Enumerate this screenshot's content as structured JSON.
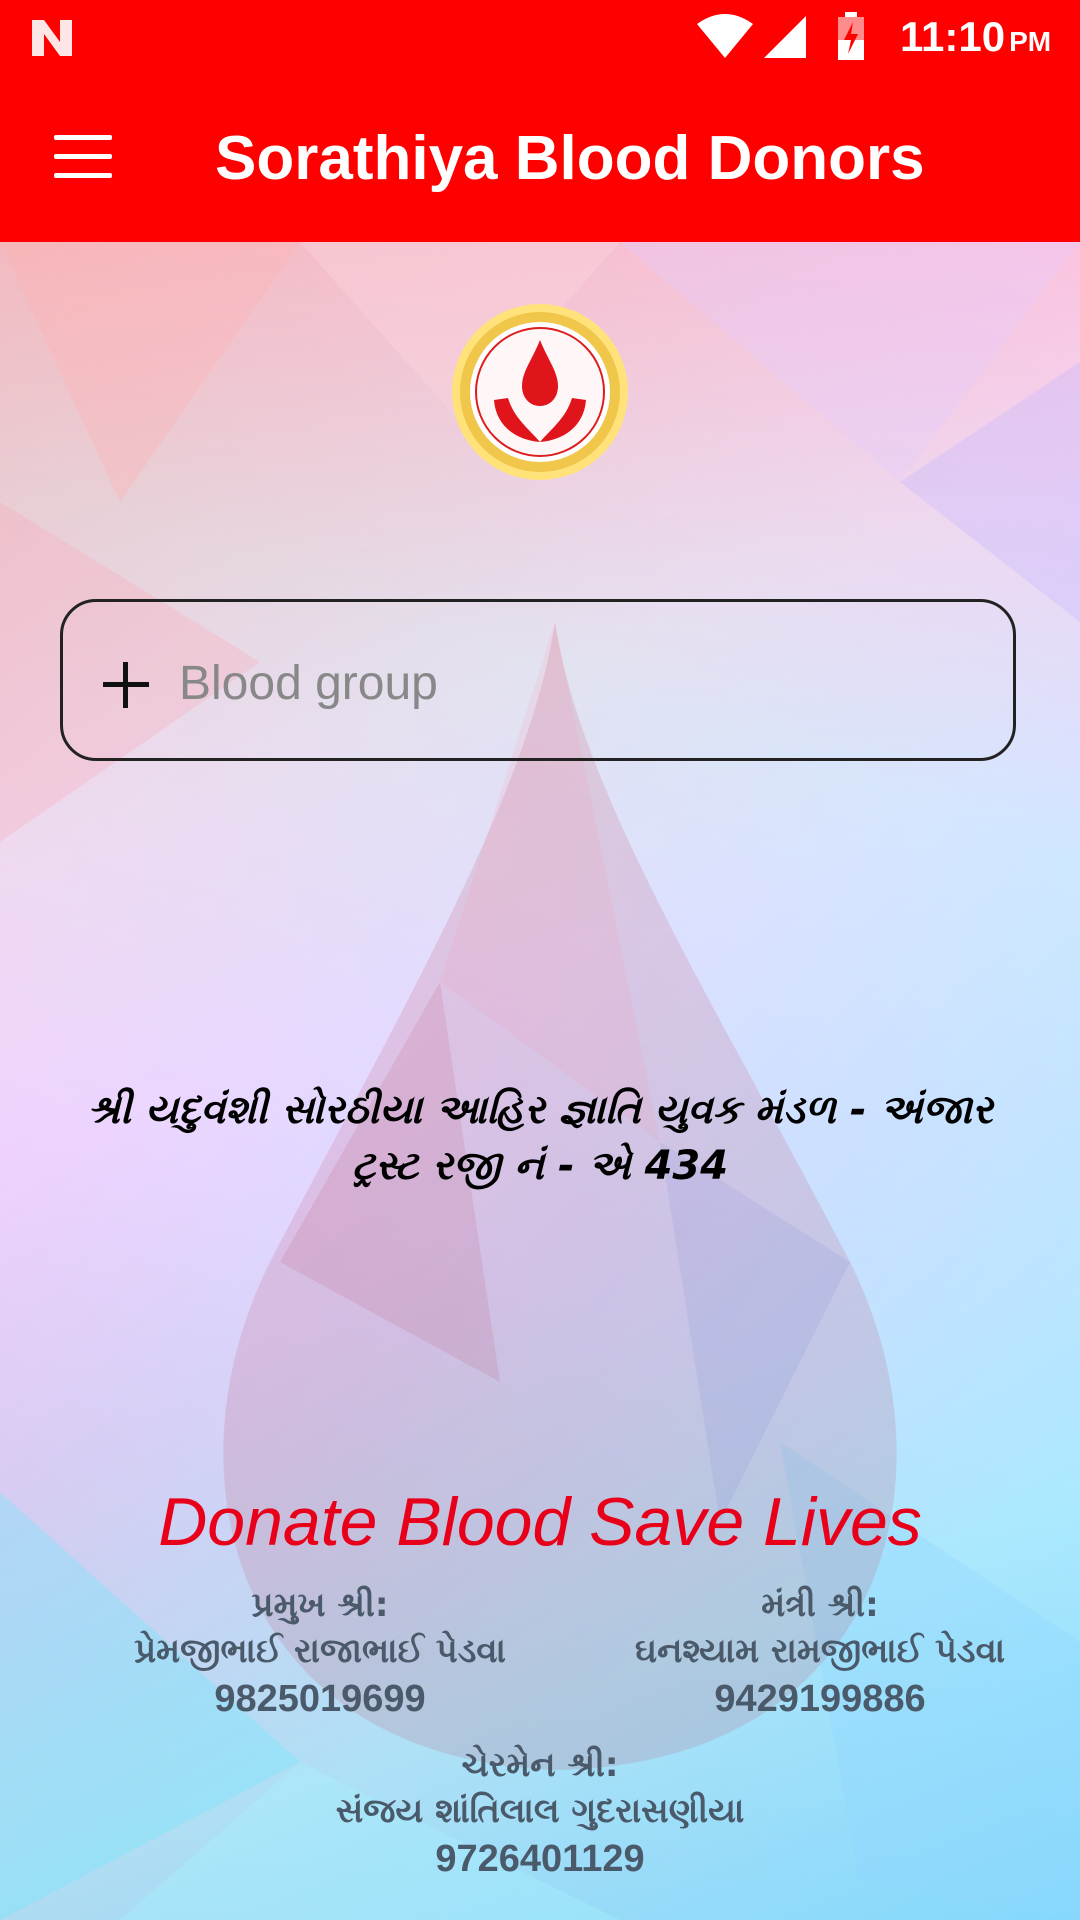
{
  "status_bar": {
    "time": "11:10",
    "ampm": "PM",
    "icons": [
      "n-logo-icon",
      "wifi-icon",
      "signal-icon",
      "battery-charging-icon"
    ]
  },
  "app_bar": {
    "title": "Sorathiya Blood Donors",
    "menu_icon": "hamburger-menu-icon"
  },
  "logo": "blood-drop-hands-logo",
  "search": {
    "placeholder": "Blood group",
    "icon": "plus-icon"
  },
  "trust": {
    "line1": "શ્રી યદુવંશી સોરઠીયા આહિર જ્ઞાતિ યુવક મંડળ - અંજાર",
    "line2": "ટ્રસ્ટ રજી નં - એ 434"
  },
  "slogan": "Donate Blood Save Lives",
  "contacts": [
    {
      "role": "પ્રમુખ શ્રી:",
      "name": "પ્રેમજીભાઈ રાજાભાઈ પેડવા",
      "phone": "9825019699"
    },
    {
      "role": "મંત્રી શ્રી:",
      "name": "ઘનશ્યામ રામજીભાઈ પેડવા",
      "phone": "9429199886"
    },
    {
      "role": "ચેરમેન શ્રી:",
      "name": "સંજય શાંતિલાલ ગુદરાસણીયા",
      "phone": "9726401129"
    }
  ],
  "colors": {
    "primary": "#ff0000",
    "slogan": "#e8001a",
    "contact_text": "#4a5a6a"
  }
}
